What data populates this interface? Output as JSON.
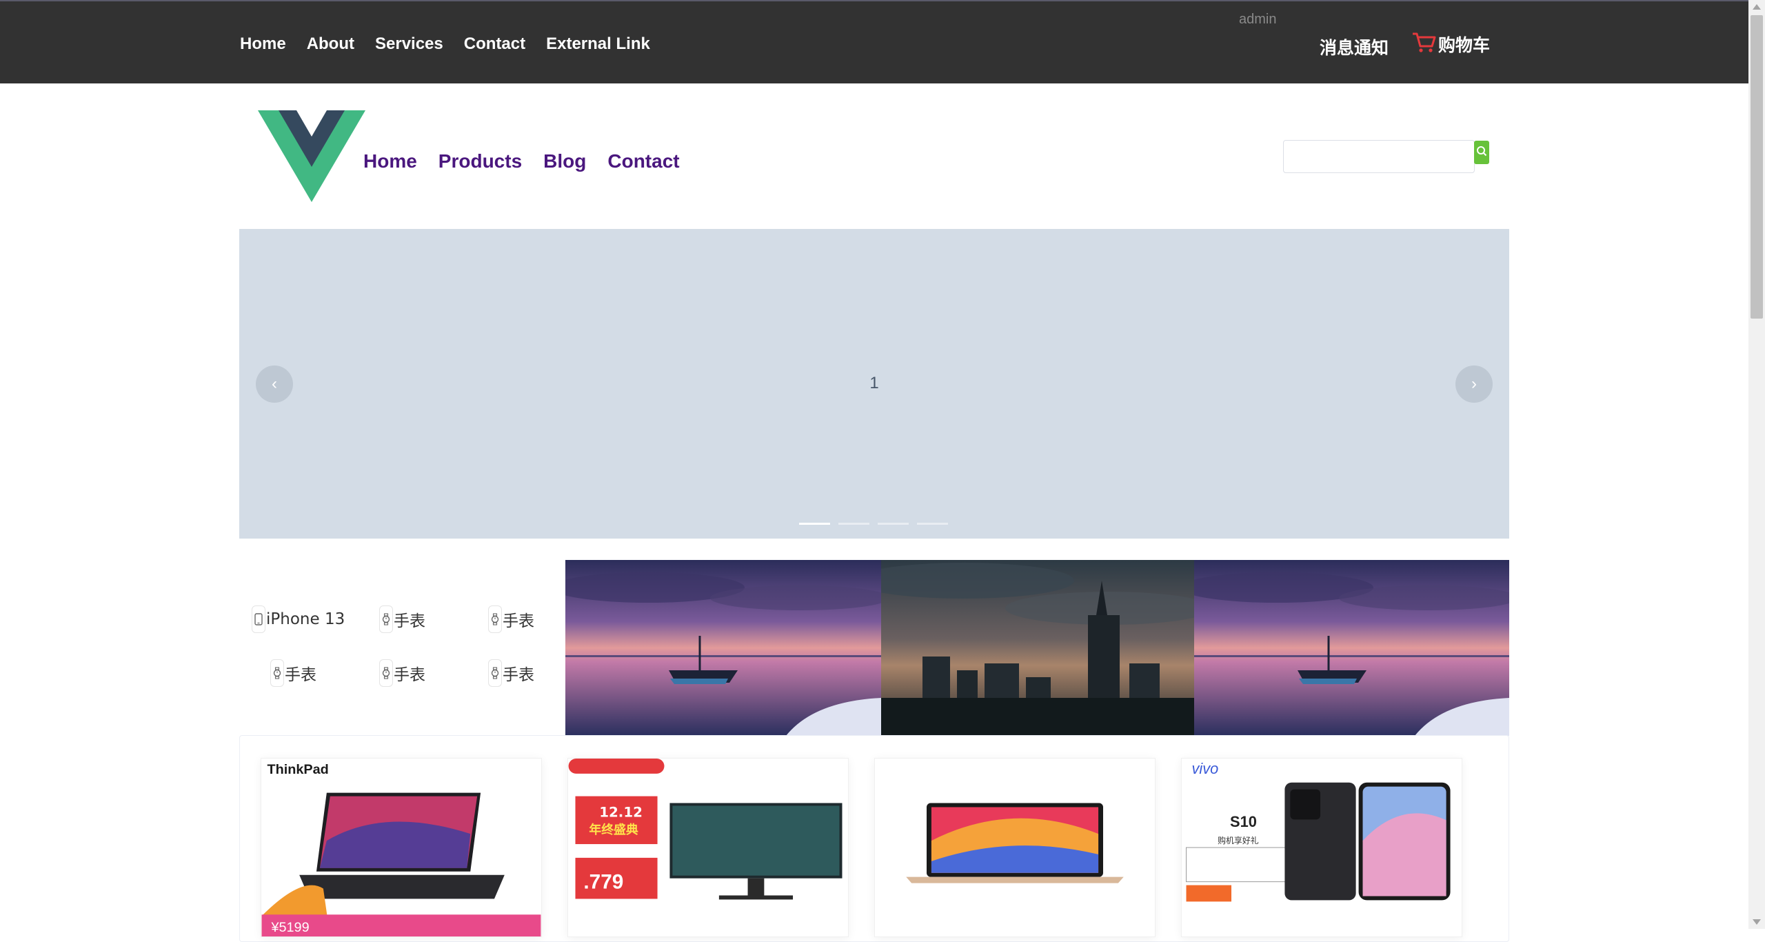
{
  "topbar": {
    "links": [
      "Home",
      "About",
      "Services",
      "Contact",
      "External Link"
    ],
    "user": "admin",
    "notifications": "消息通知",
    "cart": "购物车",
    "cart_icon": "shopping-cart-icon"
  },
  "header": {
    "logo": "vue-logo",
    "nav": [
      "Home",
      "Products",
      "Blog",
      "Contact"
    ],
    "search": {
      "placeholder": "",
      "value": "",
      "button_icon": "search-icon"
    }
  },
  "carousel": {
    "current_label": "1",
    "prev_icon": "‹",
    "next_icon": "›",
    "indicator_count": 4,
    "active_index": 0
  },
  "categories": [
    {
      "label": "iPhone 13",
      "icon": "phone-icon"
    },
    {
      "label": "手表",
      "icon": "watch-icon"
    },
    {
      "label": "手表",
      "icon": "watch-icon"
    },
    {
      "label": "手表",
      "icon": "watch-icon"
    },
    {
      "label": "手表",
      "icon": "watch-icon"
    },
    {
      "label": "手表",
      "icon": "watch-icon"
    }
  ],
  "banners": [
    "lake-boat-sunset",
    "city-tower-dusk",
    "lake-boat-sunset"
  ],
  "products": [
    {
      "brand": "ThinkPad",
      "promo": "¥5199",
      "image": "thinkpad-laptop"
    },
    {
      "promo_title": "12.12",
      "promo_sub": "年终盛典",
      "price": ".779",
      "image": "monitor"
    },
    {
      "image": "macbook-air"
    },
    {
      "brand": "vivo",
      "model": "S10",
      "tagline": "购机享好礼",
      "image": "vivo-phone"
    }
  ],
  "colors": {
    "topbar_bg": "#323232",
    "nav_purple": "#4a177e",
    "carousel_bg": "#d3dce6",
    "search_green": "#67c23a",
    "cart_red": "#e4393c"
  }
}
